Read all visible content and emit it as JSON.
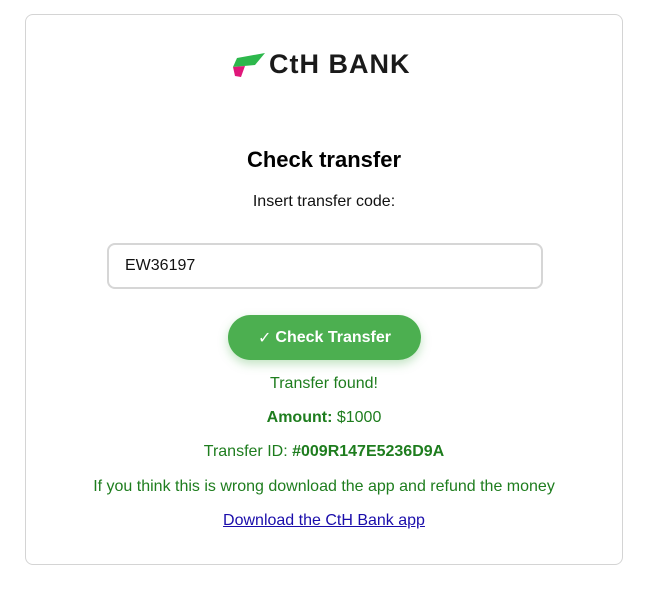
{
  "brand": {
    "name": "CtH BANK",
    "logo_icon": "cth-bank-logo-icon",
    "colors": {
      "green": "#2db84c",
      "magenta": "#e0177a",
      "text": "#1a1a1a"
    }
  },
  "form": {
    "title": "Check transfer",
    "prompt": "Insert transfer code:",
    "code_value": "EW36197",
    "button_icon": "checkmark-icon",
    "button_glyph": "✓",
    "button_label": "Check Transfer",
    "button_color": "#4caf50"
  },
  "result": {
    "status": "Transfer found!",
    "amount_label": "Amount:",
    "amount_value": "$1000",
    "id_label": "Transfer ID:",
    "id_value": "#009R147E5236D9A",
    "warning": "If you think this is wrong download the app and refund the money",
    "download_link": "Download the CtH Bank app",
    "text_color": "#1e7d1e"
  }
}
